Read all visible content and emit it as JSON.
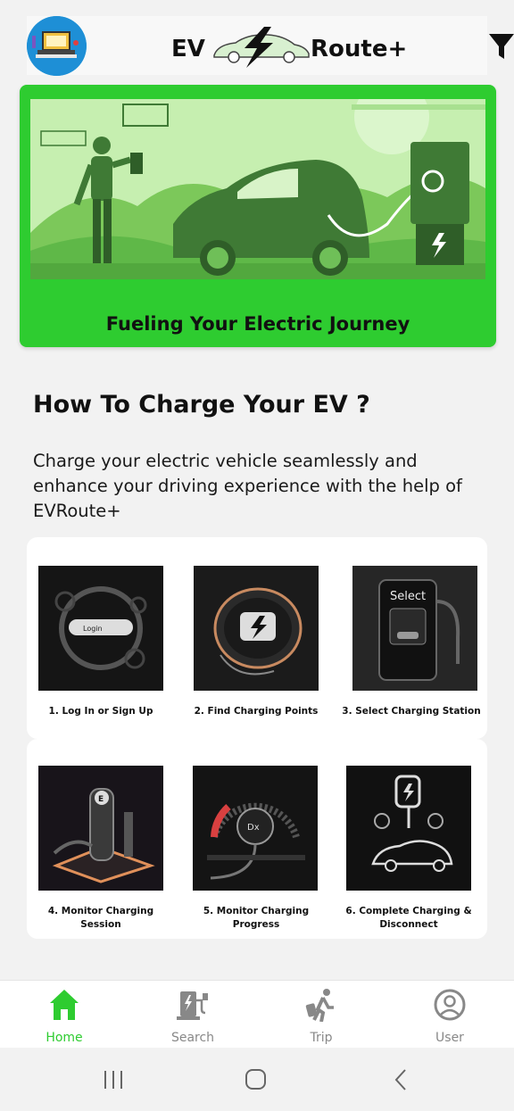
{
  "header": {
    "logo_left": "EV",
    "logo_right": "Route+",
    "avatar_icon": "laptop-avatar-icon",
    "filter_icon": "filter-icon"
  },
  "hero": {
    "caption": "Fueling Your Electric Journey",
    "accent": "#2ecc30"
  },
  "section": {
    "title": "How To Charge Your EV ?",
    "description": "Charge your electric vehicle seamlessly and enhance your driving experience with the help of EVRoute+"
  },
  "steps": [
    {
      "label": "1. Log In or Sign Up",
      "image_text": "Login"
    },
    {
      "label": "2. Find Charging Points",
      "image_text": "Find Charging Points"
    },
    {
      "label": "3. Select Charging Station",
      "image_text": "Select"
    },
    {
      "label": "4. Monitor Charging Session",
      "image_text": "E"
    },
    {
      "label": "5. Monitor Charging Progress",
      "image_text": "Dx"
    },
    {
      "label": "6. Complete Charging & Disconnect",
      "image_text": ""
    }
  ],
  "nav": {
    "items": [
      {
        "label": "Home",
        "icon": "home-icon",
        "active": true
      },
      {
        "label": "Search",
        "icon": "charging-station-icon",
        "active": false
      },
      {
        "label": "Trip",
        "icon": "walking-person-icon",
        "active": false
      },
      {
        "label": "User",
        "icon": "user-circle-icon",
        "active": false
      }
    ]
  },
  "system_nav": [
    "recent-apps-icon",
    "home-circle-icon",
    "back-icon"
  ]
}
